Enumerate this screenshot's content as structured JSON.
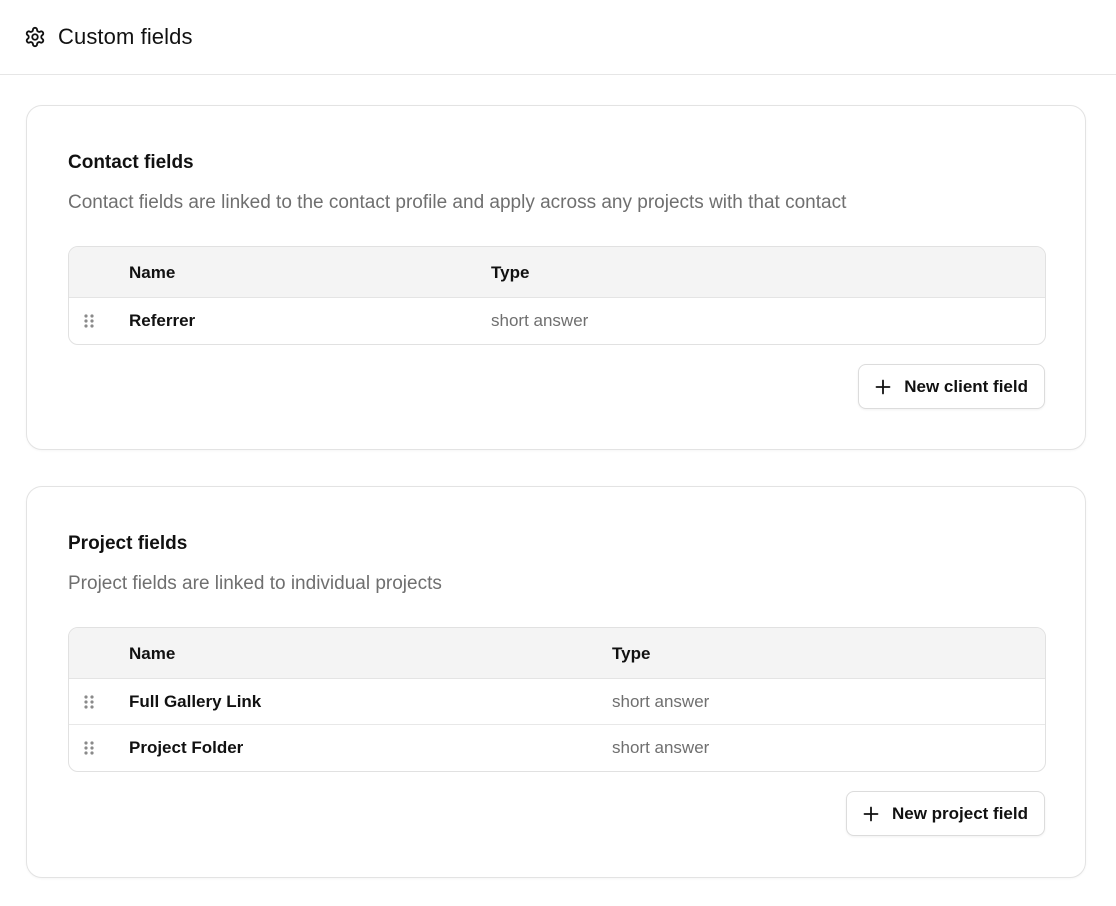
{
  "header": {
    "title": "Custom fields",
    "icon": "gear-icon"
  },
  "contact_section": {
    "title": "Contact fields",
    "description": "Contact fields are linked to the contact profile and apply across any projects with that contact",
    "columns": [
      "Name",
      "Type"
    ],
    "rows": [
      {
        "name": "Referrer",
        "type": "short answer"
      }
    ],
    "button_label": "New client field"
  },
  "project_section": {
    "title": "Project fields",
    "description": "Project fields are linked to individual projects",
    "columns": [
      "Name",
      "Type"
    ],
    "rows": [
      {
        "name": "Full Gallery Link",
        "type": "short answer"
      },
      {
        "name": "Project Folder",
        "type": "short answer"
      }
    ],
    "button_label": "New project field"
  },
  "colors": {
    "border": "#e3e3e3",
    "table_head_bg": "#f4f4f4",
    "muted_text": "#6f6f6f",
    "text": "#111111"
  }
}
